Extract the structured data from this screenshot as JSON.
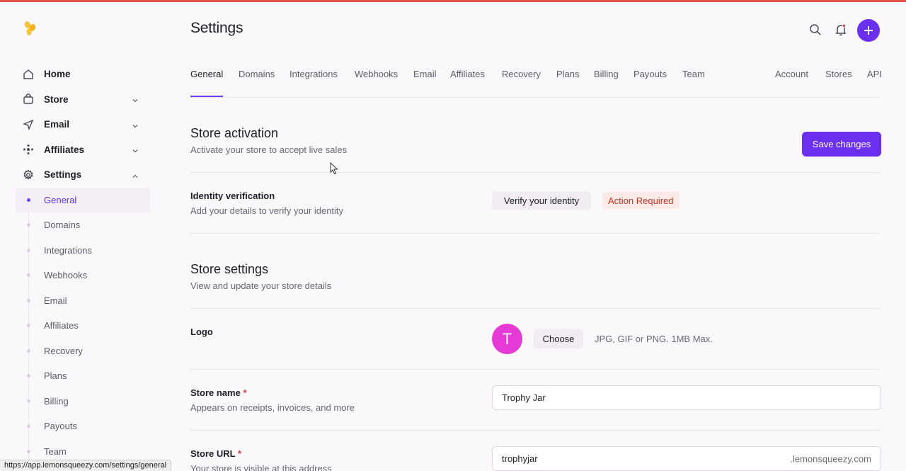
{
  "app": {
    "page_title": "Settings",
    "accent": "#6b2ff0"
  },
  "sidebar": {
    "items": [
      {
        "label": "Home",
        "icon": "home-icon"
      },
      {
        "label": "Store",
        "icon": "bag-icon"
      },
      {
        "label": "Email",
        "icon": "send-icon"
      },
      {
        "label": "Affiliates",
        "icon": "affiliates-icon"
      },
      {
        "label": "Settings",
        "icon": "gear-icon"
      }
    ],
    "settings_sub": [
      "General",
      "Domains",
      "Integrations",
      "Webhooks",
      "Email",
      "Affiliates",
      "Recovery",
      "Plans",
      "Billing",
      "Payouts",
      "Team"
    ],
    "active_sub": "General"
  },
  "tabs": {
    "left": [
      "General",
      "Domains",
      "Integrations",
      "Webhooks",
      "Email",
      "Affiliates",
      "Recovery",
      "Plans",
      "Billing",
      "Payouts",
      "Team"
    ],
    "right": [
      "Account",
      "Stores",
      "API"
    ],
    "active": "General"
  },
  "activation": {
    "title": "Store activation",
    "desc": "Activate your store to accept live sales",
    "save_label": "Save changes",
    "identity_label": "Identity verification",
    "identity_desc": "Add your details to verify your identity",
    "verify_label": "Verify your identity",
    "badge": "Action Required"
  },
  "store_settings": {
    "title": "Store settings",
    "desc": "View and update your store details",
    "logo_label": "Logo",
    "avatar_letter": "T",
    "choose_label": "Choose",
    "logo_hint": "JPG, GIF or PNG. 1MB Max.",
    "name_label": "Store name",
    "name_desc": "Appears on receipts, invoices, and more",
    "name_value": "Trophy Jar",
    "url_label": "Store URL",
    "url_desc": "Your store is visible at this address",
    "url_value": "trophyjar",
    "url_suffix": ".lemonsqueezy.com",
    "required_mark": "*"
  },
  "status_url": "https://app.lemonsqueezy.com/settings/general"
}
